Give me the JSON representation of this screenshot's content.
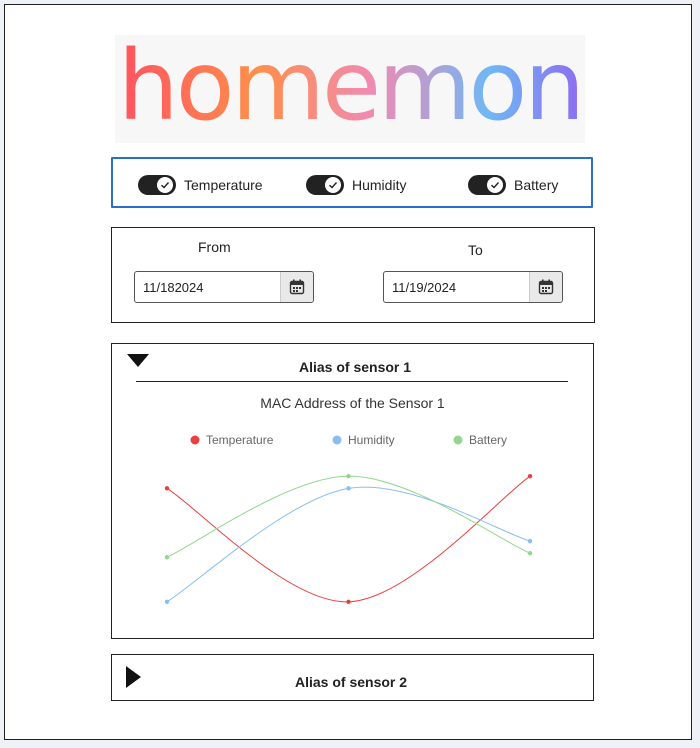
{
  "logo": {
    "text": "homemon"
  },
  "toggles": [
    {
      "label": "Temperature",
      "checked": true
    },
    {
      "label": "Humidity",
      "checked": true
    },
    {
      "label": "Battery",
      "checked": true
    }
  ],
  "dates": {
    "from_label": "From",
    "to_label": "To",
    "from_value": "11/182024",
    "to_value": "11/19/2024"
  },
  "sensors": [
    {
      "alias": "Alias of sensor 1",
      "expanded": true,
      "mac_label": "MAC Address of the Sensor 1"
    },
    {
      "alias": "Alias of sensor 2",
      "expanded": false
    }
  ],
  "chart_data": {
    "type": "line",
    "curve": "smooth",
    "title": "",
    "x": [
      1,
      2,
      3
    ],
    "legend_position": "top",
    "grid": false,
    "axes_visible": false,
    "series": [
      {
        "name": "Temperature",
        "color": "#e8413f",
        "values": [
          58,
          30,
          61
        ]
      },
      {
        "name": "Humidity",
        "color": "#86bff0",
        "values": [
          30,
          58,
          45
        ]
      },
      {
        "name": "Battery",
        "color": "#94d68f",
        "values": [
          41,
          61,
          42
        ]
      }
    ],
    "ylim": [
      27,
      64
    ]
  }
}
